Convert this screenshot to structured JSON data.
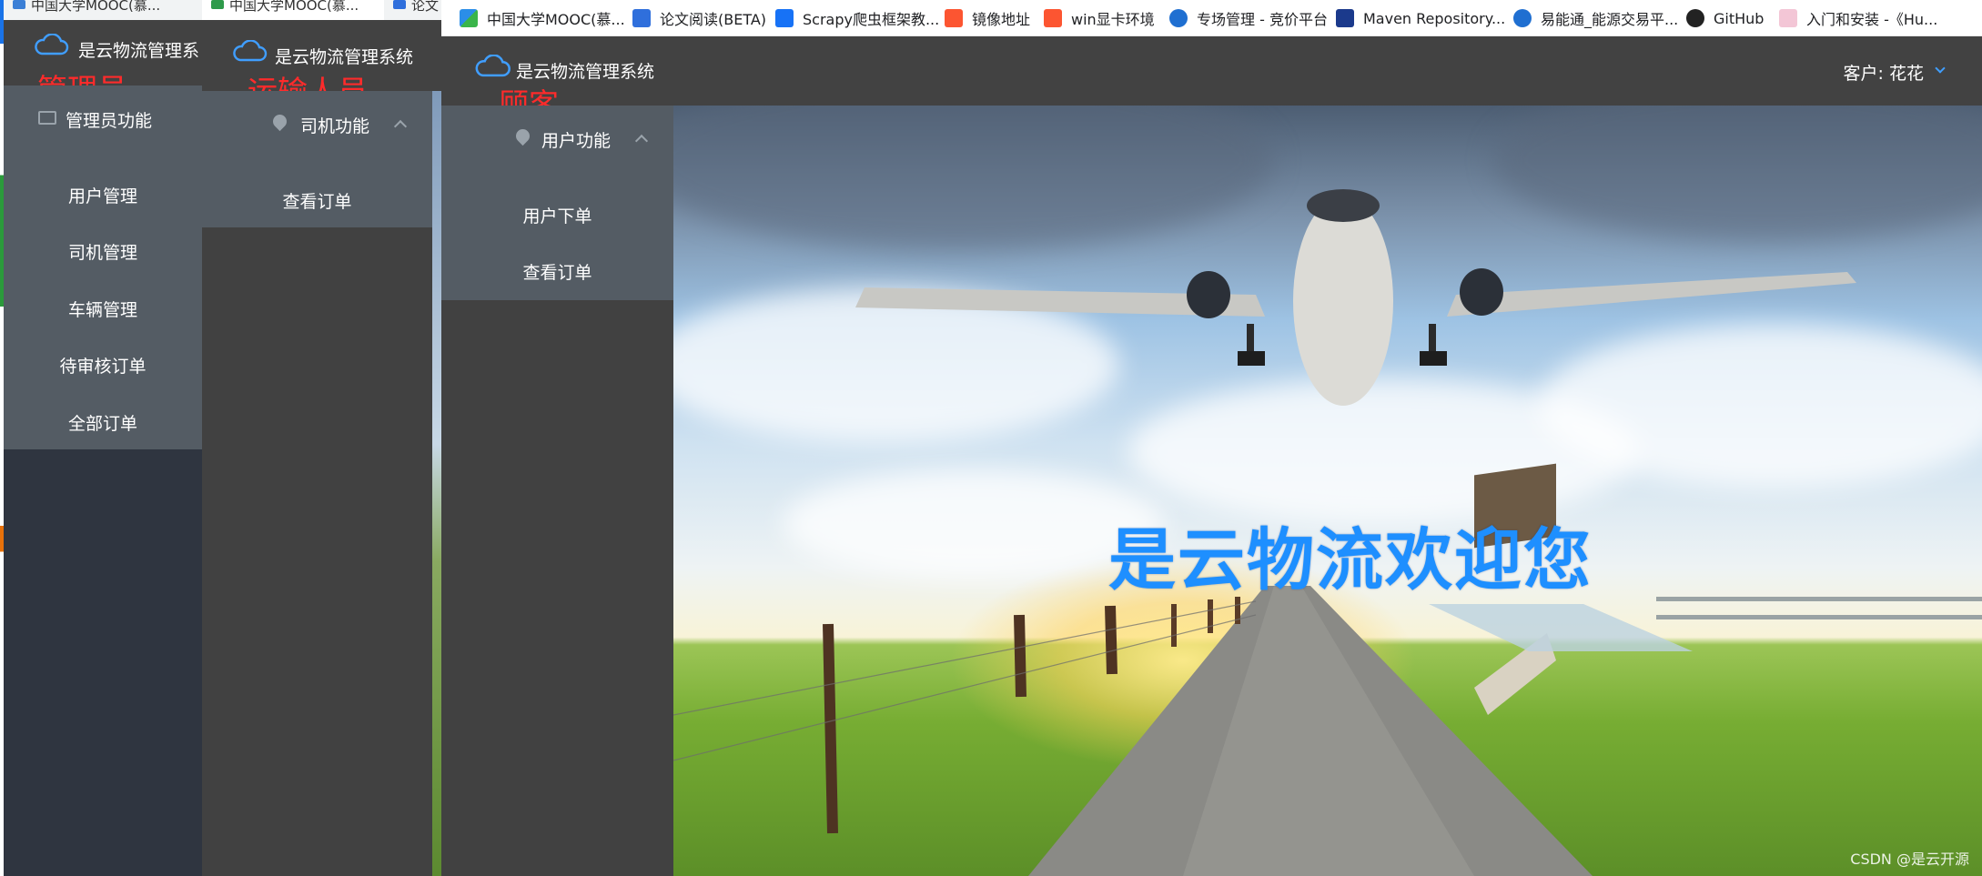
{
  "bookmarks": [
    {
      "label": "中国大学MOOC(慕...",
      "icon": "mooc-icon",
      "color": "#2b8ee8"
    },
    {
      "label": "论文阅读(BETA)",
      "icon": "paper-reading-icon",
      "color": "#2f6fdc"
    },
    {
      "label": "Scrapy爬虫框架教...",
      "icon": "zhihu-icon",
      "color": "#1772f6"
    },
    {
      "label": "镜像地址",
      "icon": "csdn-icon",
      "color": "#fc5531"
    },
    {
      "label": "win显卡环境",
      "icon": "csdn-icon",
      "color": "#fc5531"
    },
    {
      "label": "专场管理 - 竞价平台",
      "icon": "platform-icon",
      "color": "#1f6fd1"
    },
    {
      "label": "Maven Repository...",
      "icon": "maven-icon",
      "color": "#1b3a8c"
    },
    {
      "label": "易能通_能源交易平...",
      "icon": "platform-icon",
      "color": "#1f6fd1"
    },
    {
      "label": "GitHub",
      "icon": "github-icon",
      "color": "#222222"
    },
    {
      "label": "入门和安装 -《Hu...",
      "icon": "doc-icon",
      "color": "#e86a9a"
    }
  ],
  "admin": {
    "tab": "中国大学MOOC(慕...",
    "brand": "是云物流管理系",
    "role": "管理员",
    "menu_title": "管理员功能",
    "items": [
      "用户管理",
      "司机管理",
      "车辆管理",
      "待审核订单",
      "全部订单"
    ]
  },
  "driver": {
    "tabs": [
      "中国大学MOOC(慕...",
      "论文"
    ],
    "brand": "是云物流管理系统",
    "role": "运输人员",
    "menu_title": "司机功能",
    "items": [
      "查看订单"
    ]
  },
  "customer": {
    "brand": "是云物流管理系统",
    "role": "顾客",
    "menu_title": "用户功能",
    "items": [
      "用户下单",
      "查看订单"
    ],
    "user_label": "客户:",
    "user_name": "花花"
  },
  "hero": {
    "welcome": "是云物流欢迎您",
    "watermark": "CSDN @是云开源"
  },
  "colors": {
    "header": "#424242",
    "menu": "#545c64",
    "accent": "#409eff",
    "role_label": "#ff2b2b",
    "welcome": "#1e8fff"
  }
}
